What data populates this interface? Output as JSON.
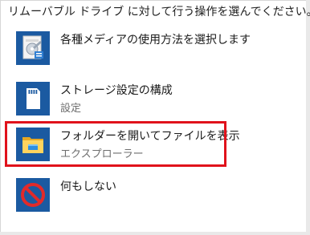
{
  "header": {
    "prompt": "リムーバブル ドライブ に対して行う操作を選んでください。"
  },
  "options": [
    {
      "title": "各種メディアの使用方法を選択します",
      "subtitle": "",
      "icon": "media-settings-icon"
    },
    {
      "title": "ストレージ設定の構成",
      "subtitle": "設定",
      "icon": "storage-card-icon"
    },
    {
      "title": "フォルダーを開いてファイルを表示",
      "subtitle": "エクスプローラー",
      "icon": "folder-icon",
      "highlighted": true
    },
    {
      "title": "何もしない",
      "subtitle": "",
      "icon": "no-action-icon"
    }
  ],
  "colors": {
    "tile_blue": "#1b5aa1",
    "highlight_red": "#e0121b",
    "text": "#1a1a1a",
    "subtext": "#6e6e6e"
  }
}
